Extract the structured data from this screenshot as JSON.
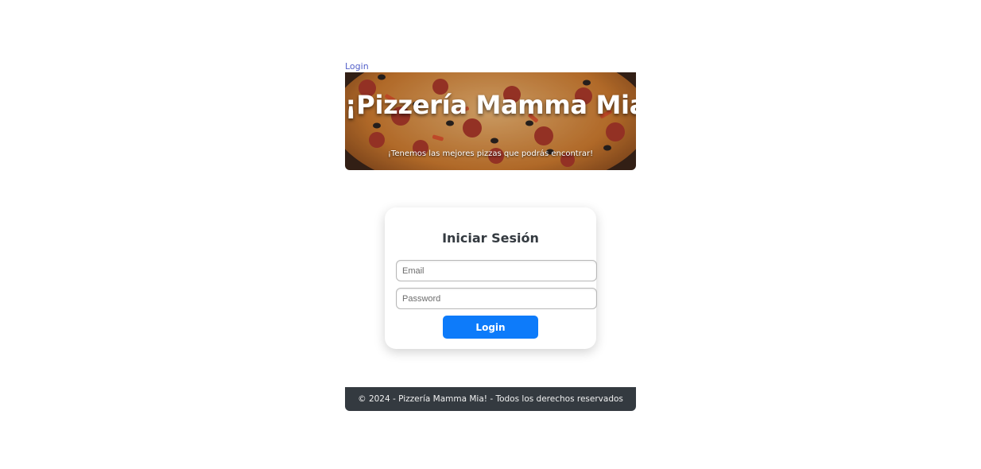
{
  "nav": {
    "login_link": "Login"
  },
  "header": {
    "title": "¡Pizzería Mamma Mia!",
    "subtitle": "¡Tenemos las mejores pizzas que podrás encontrar!",
    "background_image": "pizza-photo"
  },
  "login_form": {
    "title": "Iniciar Sesión",
    "email": {
      "value": "",
      "placeholder": "Email"
    },
    "password": {
      "value": "",
      "placeholder": "Password"
    },
    "submit_label": "Login"
  },
  "footer": {
    "text": "© 2024 - Pizzería Mamma Mia! - Todos los derechos reservados"
  },
  "colors": {
    "link": "#5360c9",
    "primary_button": "#0d7bfa",
    "footer_bg": "#343a40",
    "card_title": "#343a40"
  }
}
